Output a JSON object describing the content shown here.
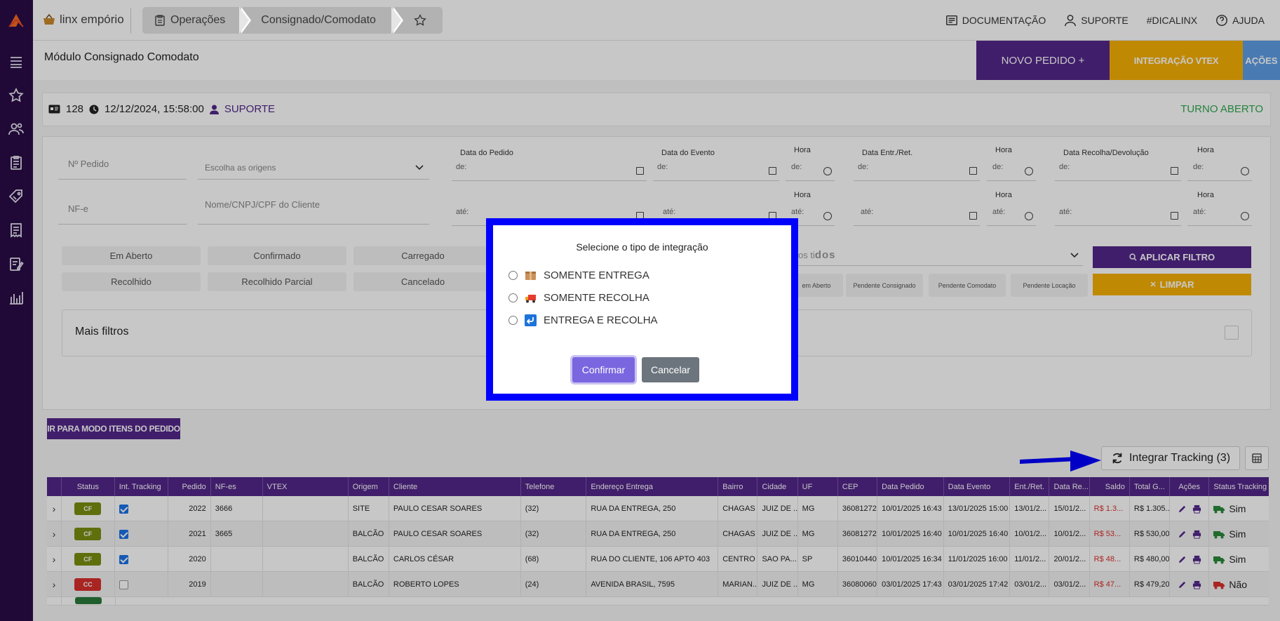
{
  "brand": {
    "name": "linx empório"
  },
  "breadcrumb": {
    "items": [
      "Operações",
      "Consignado/Comodato"
    ]
  },
  "top_links": {
    "doc": "DOCUMENTAÇÃO",
    "suporte": "SUPORTE",
    "dica": "#DICALINX",
    "ajuda": "AJUDA"
  },
  "module": {
    "title": "Módulo Consignado Comodato",
    "novo_pedido": "NOVO PEDIDO +",
    "integracao_vtex": "INTEGRAÇÃO VTEX",
    "acoes": "AÇÕES"
  },
  "info": {
    "caixa": "128",
    "datetime": "12/12/2024, 15:58:00",
    "user": "SUPORTE",
    "turno": "TURNO ABERTO"
  },
  "filters": {
    "n_pedido": "Nº Pedido",
    "origens": "Escolha as origens",
    "nfe": "NF-e",
    "cliente": "Nome/CNPJ/CPF do Cliente",
    "data_pedido": "Data do Pedido",
    "data_evento": "Data do Evento",
    "data_entr": "Data Entr./Ret.",
    "data_recolha": "Data Recolha/Devolução",
    "hora": "Hora",
    "de": "de:",
    "ate": "até:",
    "tipos_text": "os ti",
    "tipos_bold": "dos",
    "status_row1": [
      "Em Aberto",
      "Confirmado",
      "Carregado"
    ],
    "status_row2": [
      "Recolhido",
      "Recolhido Parcial",
      "Cancelado"
    ],
    "pend": [
      "em Aberto",
      "Pendente Consignado",
      "Pendente Comodato",
      "Pendente Locação"
    ],
    "aplicar": "APLICAR FILTRO",
    "limpar": "LIMPAR",
    "mais": "Mais filtros"
  },
  "actions": {
    "itens_mode": "IR PARA MODO ITENS DO PEDIDO",
    "integrar": "Integrar Tracking (3)"
  },
  "table": {
    "headers": [
      "",
      "Status",
      "Int. Tracking",
      "Pedido",
      "NF-es",
      "VTEX",
      "Origem",
      "Cliente",
      "Telefone",
      "Endereço Entrega",
      "Bairro",
      "Cidade",
      "UF",
      "CEP",
      "Data Pedido",
      "Data Evento",
      "Ent./Ret.",
      "Data Re...",
      "Saldo",
      "Total G...",
      "Ações",
      "Status Tracking"
    ],
    "rows": [
      {
        "status": "CF",
        "tracked": true,
        "pedido": "2022",
        "nfes": "3666",
        "vtex": "",
        "origem": "SITE",
        "cliente": "PAULO CESAR SOARES",
        "telefone": "(32)",
        "endereco": "RUA DA ENTREGA, 250",
        "bairro": "CHAGAS",
        "cidade": "JUIZ DE ...",
        "uf": "MG",
        "cep": "36081272",
        "data_pedido": "10/01/2025 16:43",
        "data_evento": "13/01/2025 15:00",
        "ent": "13/01/2...",
        "data_re": "15/01/2...",
        "saldo": "R$ 1.3...",
        "total": "R$ 1.305...",
        "tracking": "Sim"
      },
      {
        "status": "CF",
        "tracked": true,
        "pedido": "2021",
        "nfes": "3665",
        "vtex": "",
        "origem": "BALCÃO",
        "cliente": "PAULO CESAR SOARES",
        "telefone": "(32)",
        "endereco": "RUA DA ENTREGA, 250",
        "bairro": "CHAGAS",
        "cidade": "JUIZ DE ...",
        "uf": "MG",
        "cep": "36081272",
        "data_pedido": "10/01/2025 16:40",
        "data_evento": "10/01/2025 16:40",
        "ent": "10/01/2...",
        "data_re": "10/01/2...",
        "saldo": "R$ 53...",
        "total": "R$ 530,00",
        "tracking": "Sim"
      },
      {
        "status": "CF",
        "tracked": true,
        "pedido": "2020",
        "nfes": "",
        "vtex": "",
        "origem": "BALCÃO",
        "cliente": "CARLOS CÉSAR",
        "telefone": "(68)",
        "endereco": "RUA DO CLIENTE, 106 APTO 403",
        "bairro": "CENTRO",
        "cidade": "SAO PA...",
        "uf": "SP",
        "cep": "36010440",
        "data_pedido": "10/01/2025 16:34",
        "data_evento": "11/01/2025 16:00",
        "ent": "11/01/2...",
        "data_re": "20/01/2...",
        "saldo": "R$ 48...",
        "total": "R$ 480,00",
        "tracking": "Sim"
      },
      {
        "status": "CC",
        "tracked": false,
        "pedido": "2019",
        "nfes": "",
        "vtex": "",
        "origem": "BALCÃO",
        "cliente": "ROBERTO LOPES",
        "telefone": "(24)",
        "endereco": "AVENIDA BRASIL, 7595",
        "bairro": "MARIAN...",
        "cidade": "JUIZ DE ...",
        "uf": "MG",
        "cep": "36080060",
        "data_pedido": "03/01/2025 17:43",
        "data_evento": "03/01/2025 17:42",
        "ent": "03/01/2...",
        "data_re": "03/01/2...",
        "saldo": "R$ 47...",
        "total": "R$ 479,20",
        "tracking": "Não"
      }
    ]
  },
  "modal": {
    "title": "Selecione o tipo de integração",
    "options": [
      "SOMENTE ENTREGA",
      "SOMENTE RECOLHA",
      "ENTREGA E RECOLHA"
    ],
    "confirm": "Confirmar",
    "cancel": "Cancelar"
  },
  "colors": {
    "purple": "#53278a",
    "yellow": "#f6b006",
    "sidebar": "#2b0c47",
    "modal_border": "#0000ff",
    "green": "#2fa84f",
    "red": "#d9302c"
  }
}
